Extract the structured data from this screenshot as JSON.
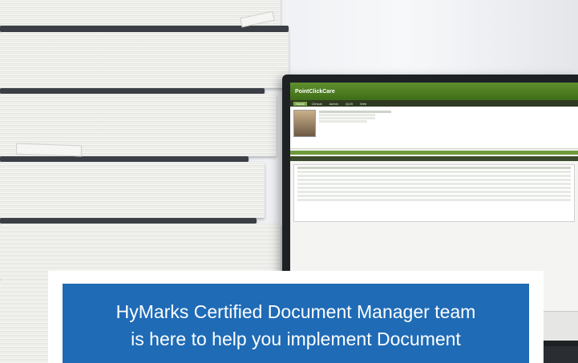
{
  "banner": {
    "line1": "HyMarks Certified Document Manager team",
    "line2": "is here to help you implement Document"
  },
  "monitor_app": {
    "logo": "PointClickCare",
    "tabs": [
      "Home",
      "Clinical",
      "Admin",
      "QLIB",
      "Web"
    ]
  },
  "colors": {
    "banner_blue": "#1f6bb6",
    "app_green": "#5e8f2d"
  }
}
